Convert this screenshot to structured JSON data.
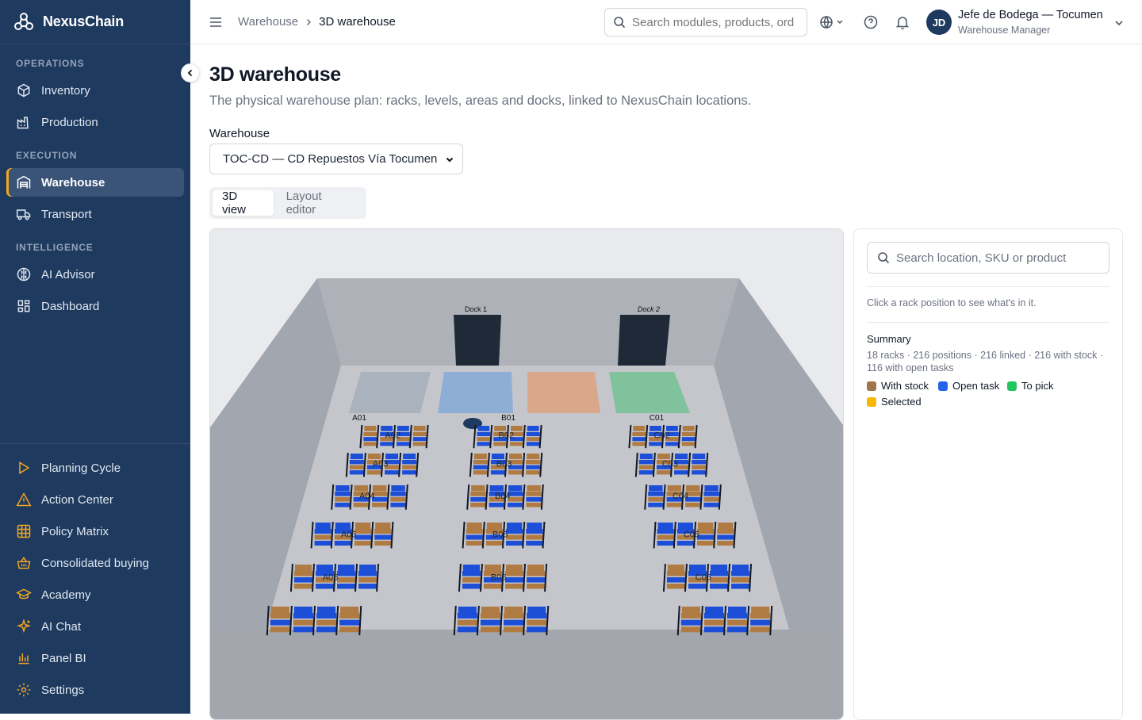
{
  "app": {
    "name": "NexusChain"
  },
  "sidebar": {
    "sections": {
      "operations": "OPERATIONS",
      "execution": "EXECUTION",
      "intelligence": "INTELLIGENCE"
    },
    "items": {
      "inventory": "Inventory",
      "production": "Production",
      "warehouse": "Warehouse",
      "transport": "Transport",
      "ai_advisor": "AI Advisor",
      "dashboard": "Dashboard",
      "planning_cycle": "Planning Cycle",
      "action_center": "Action Center",
      "policy_matrix": "Policy Matrix",
      "consolidated_buying": "Consolidated buying",
      "academy": "Academy",
      "ai_chat": "AI Chat",
      "panel_bi": "Panel BI",
      "settings": "Settings"
    },
    "active": "warehouse",
    "accent": "#f5a623"
  },
  "topbar": {
    "breadcrumb": [
      "Warehouse",
      "3D warehouse"
    ],
    "search_placeholder": "Search modules, products, orders",
    "user": {
      "initials": "JD",
      "name": "Jefe de Bodega — Tocumen",
      "role": "Warehouse Manager"
    }
  },
  "page": {
    "title": "3D warehouse",
    "subtitle": "The physical warehouse plan: racks, levels, areas and docks, linked to NexusChain locations.",
    "warehouse_label": "Warehouse",
    "warehouse_value": "TOC-CD — CD Repuestos Vía Tocumen",
    "tabs": [
      "3D view",
      "Layout editor"
    ],
    "active_tab": "3D view"
  },
  "scene": {
    "docks": [
      "Dock 1",
      "Dock 2"
    ],
    "row_heads": [
      "A01",
      "B01",
      "C01"
    ],
    "rack_labels": {
      "A": [
        "A02",
        "A03",
        "A04",
        "A05",
        "A06"
      ],
      "B": [
        "B02",
        "B03",
        "B04",
        "B05",
        "B06"
      ],
      "C": [
        "C02",
        "C03",
        "C04",
        "C05",
        "C06"
      ]
    },
    "area_colors": [
      "#aab2bd",
      "#8faed6",
      "#d9a88a",
      "#7fc29b"
    ],
    "stock_color": "#b07a43",
    "task_color": "#1d4ed8"
  },
  "panel": {
    "search_placeholder": "Search location, SKU or product",
    "hint": "Click a rack position to see what's in it.",
    "summary_title": "Summary",
    "summary_text": "18 racks · 216 positions · 216 linked · 216 with stock · 116 with open tasks",
    "legend": [
      {
        "label": "With stock",
        "color": "#a0764a"
      },
      {
        "label": "Open task",
        "color": "#2563eb"
      },
      {
        "label": "To pick",
        "color": "#22c55e"
      },
      {
        "label": "Selected",
        "color": "#f5b800"
      }
    ]
  }
}
